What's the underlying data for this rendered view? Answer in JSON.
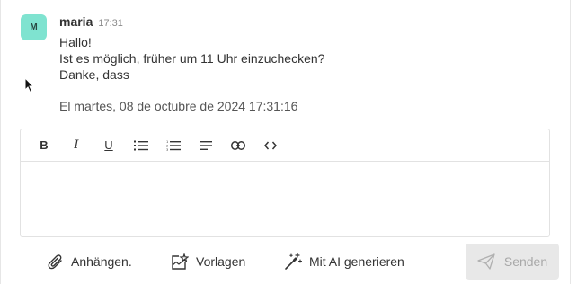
{
  "message": {
    "avatar_initial": "M",
    "author": "maria",
    "time": "17:31",
    "lines": [
      "Hallo!",
      "Ist es möglich, früher um 11 Uhr einzuchecken?",
      "Danke, dass"
    ],
    "date_label": "El martes, 08 de octubre de 2024 17:31:16"
  },
  "toolbar": {
    "bold": "B",
    "italic": "I",
    "underline": "U"
  },
  "editor": {
    "value": "",
    "placeholder": ""
  },
  "actions": {
    "attach": "Anhängen.",
    "templates": "Vorlagen",
    "ai": "Mit AI generieren",
    "send": "Senden"
  },
  "colors": {
    "avatar_bg": "#7fe3d0",
    "send_bg": "#e8e8e8",
    "send_text": "#a8a8a8"
  }
}
